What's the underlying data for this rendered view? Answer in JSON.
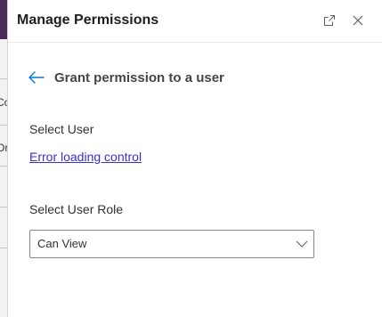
{
  "panel": {
    "title": "Manage Permissions",
    "expand_icon": "expand-icon",
    "close_icon": "close-icon"
  },
  "background": {
    "fragment_1": "Co",
    "fragment_2": "Or"
  },
  "form": {
    "back_icon": "back-arrow-icon",
    "subtitle": "Grant permission to a user",
    "select_user_label": "Select User",
    "error_text": "Error loading control",
    "select_role_label": "Select User Role",
    "role_value": "Can View",
    "chevron_icon": "chevron-down-icon"
  },
  "colors": {
    "accent": "#0078d4",
    "link": "#3a2fd1",
    "header_band": "#4b2a58"
  }
}
